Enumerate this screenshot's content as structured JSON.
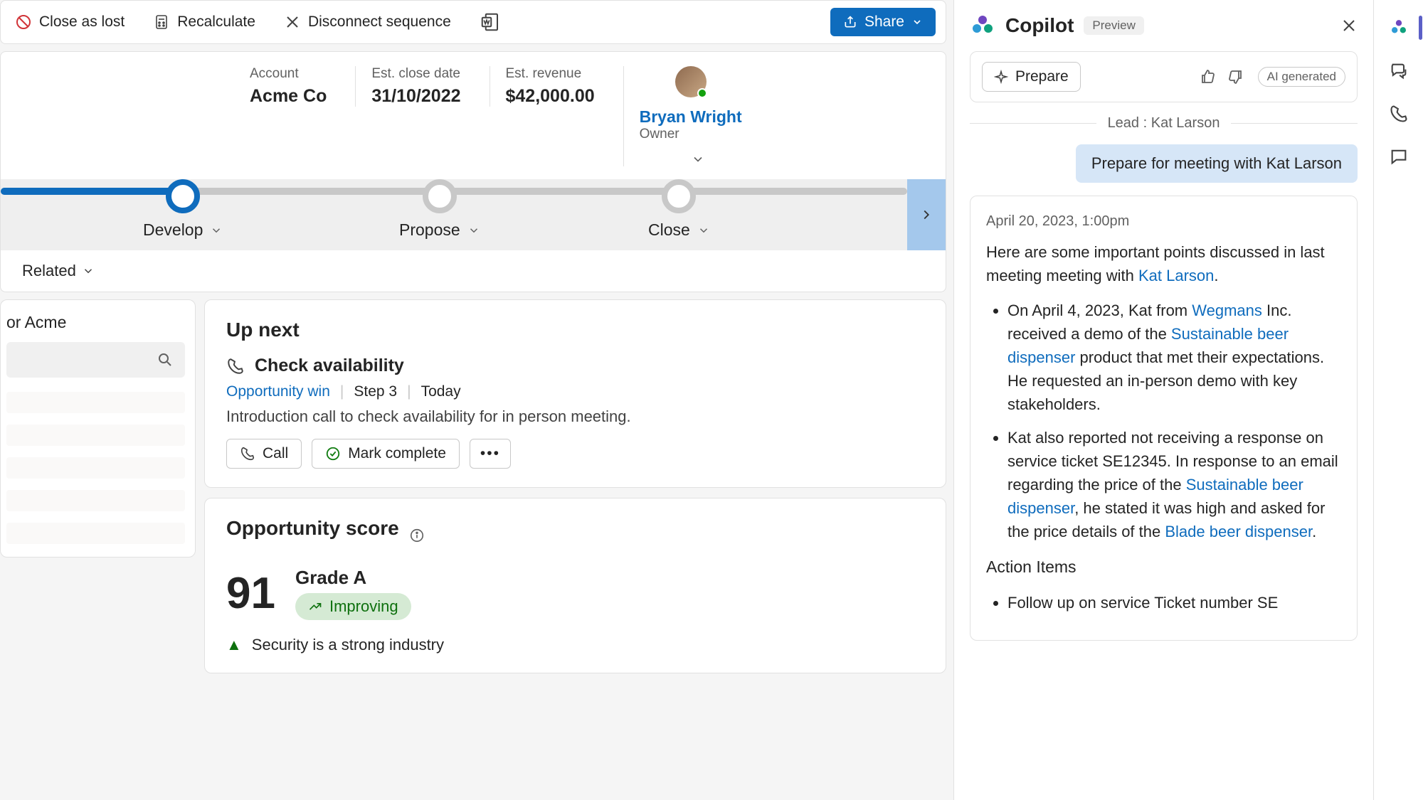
{
  "toolbar": {
    "close_as_lost": "Close as lost",
    "recalculate": "Recalculate",
    "disconnect": "Disconnect sequence",
    "share": "Share"
  },
  "summary": {
    "account_label": "Account",
    "account_value": "Acme Co",
    "close_date_label": "Est. close date",
    "close_date_value": "31/10/2022",
    "revenue_label": "Est. revenue",
    "revenue_value": "$42,000.00",
    "owner_name": "Bryan Wright",
    "owner_role": "Owner"
  },
  "bpf": {
    "stages": [
      "Develop",
      "Propose",
      "Close"
    ]
  },
  "related": "Related",
  "left_pane": {
    "title": "or Acme"
  },
  "up_next": {
    "heading": "Up next",
    "task": "Check availability",
    "link": "Opportunity win",
    "step": "Step 3",
    "when": "Today",
    "desc": "Introduction call to check availability for in person meeting.",
    "call_btn": "Call",
    "complete_btn": "Mark complete"
  },
  "score": {
    "heading": "Opportunity score",
    "value": "91",
    "grade": "Grade A",
    "trend": "Improving",
    "insight": "Security is a strong industry"
  },
  "copilot": {
    "title": "Copilot",
    "badge": "Preview",
    "prepare": "Prepare",
    "ai": "AI generated",
    "lead_line": "Lead : Kat Larson",
    "suggestion": "Prepare for meeting with Kat Larson",
    "ts": "April 20, 2023, 1:00pm",
    "intro_a": "Here are some important points discussed in last meeting meeting with ",
    "intro_link": "Kat Larson",
    "b1_a": "On April 4, 2023, Kat from ",
    "b1_l1": "Wegmans",
    "b1_b": " Inc. received a demo of the ",
    "b1_l2": "Sustainable beer dispenser",
    "b1_c": " product that met their expectations. He requested an in-person demo with key stakeholders.",
    "b2_a": "Kat also reported not receiving a response on service ticket SE12345. In response to an email regarding the price of the ",
    "b2_l1": "Sustainable beer dispenser",
    "b2_b": ", he stated it was high and asked for the price details of the ",
    "b2_l2": "Blade beer dispenser",
    "b2_c": ".",
    "action_h": "Action Items",
    "action_1": "Follow up on service Ticket number SE"
  }
}
